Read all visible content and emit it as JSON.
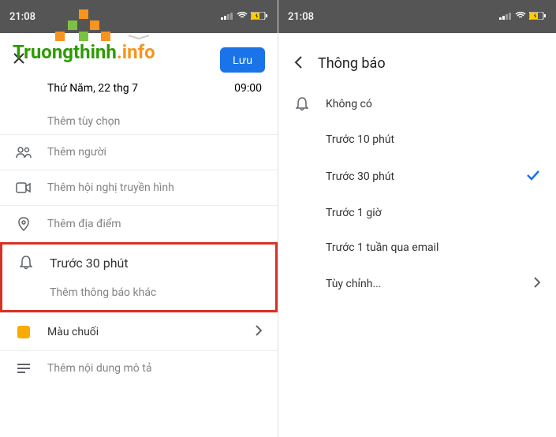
{
  "status": {
    "time": "21:08",
    "signal": "•ıl",
    "wifi": "wifi",
    "battery": "battery"
  },
  "watermark": {
    "part1": "Truongthinh",
    "part2": ".info"
  },
  "left": {
    "save": "Lưu",
    "date": "Thứ Năm, 22 thg 7",
    "time": "09:00",
    "more_options": "Thêm tùy chọn",
    "add_people": "Thêm người",
    "add_video": "Thêm hội nghị truyền hình",
    "add_location": "Thêm địa điểm",
    "notification": "Trước 30 phút",
    "add_notification": "Thêm thông báo khác",
    "color_label": "Màu chuối",
    "add_description": "Thêm nội dung mô tả"
  },
  "right": {
    "title": "Thông báo",
    "options": {
      "none": "Không có",
      "min10": "Trước 10 phút",
      "min30": "Trước 30 phút",
      "hour1": "Trước 1 giờ",
      "week1": "Trước 1 tuần qua email",
      "custom": "Tùy chỉnh..."
    }
  }
}
